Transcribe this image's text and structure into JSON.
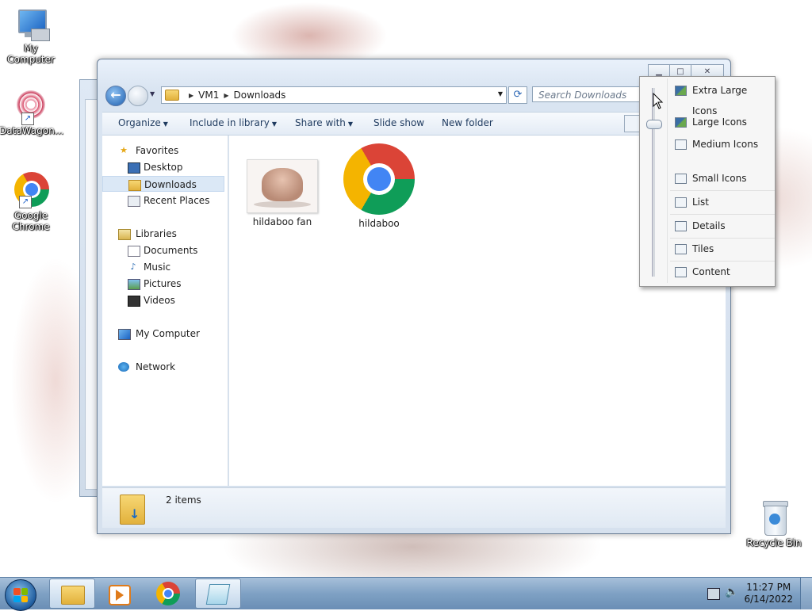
{
  "desktop": {
    "icons": [
      {
        "label": "My Computer"
      },
      {
        "label": "DataWagon..."
      },
      {
        "label": "Google Chrome"
      },
      {
        "label": "Recycle Bin"
      }
    ]
  },
  "window": {
    "address": {
      "root": "VM1",
      "folder": "Downloads"
    },
    "search": {
      "placeholder": "Search Downloads"
    },
    "commands": {
      "organize": "Organize",
      "include": "Include in library",
      "share": "Share with",
      "slideshow": "Slide show",
      "newfolder": "New folder"
    },
    "nav": {
      "favorites": "Favorites",
      "desktop": "Desktop",
      "downloads": "Downloads",
      "recent": "Recent Places",
      "libraries": "Libraries",
      "documents": "Documents",
      "music": "Music",
      "pictures": "Pictures",
      "videos": "Videos",
      "computer": "My Computer",
      "network": "Network"
    },
    "files": [
      {
        "name": "hildaboo fan"
      },
      {
        "name": "hildaboo"
      }
    ],
    "status": {
      "items": "2 items"
    }
  },
  "view_menu": {
    "options": [
      "Extra Large Icons",
      "Large Icons",
      "Medium Icons",
      "Small Icons",
      "List",
      "Details",
      "Tiles",
      "Content"
    ]
  },
  "taskbar": {
    "time": "11:27 PM",
    "date": "6/14/2022"
  }
}
